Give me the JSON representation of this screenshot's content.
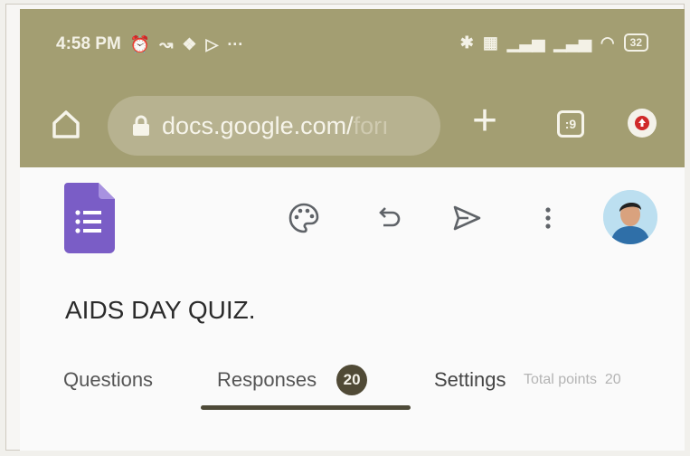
{
  "status_bar": {
    "time": "4:58 PM",
    "battery": "32"
  },
  "browser": {
    "url_main": "docs.google.com/",
    "url_faded": "forı",
    "tab_count": ":9"
  },
  "app": {
    "form_title": "AIDS DAY QUIZ.",
    "tabs": {
      "questions": "Questions",
      "responses": "Responses",
      "responses_count": "20",
      "settings": "Settings"
    },
    "total_points_label": "Total points",
    "total_points_value": "20"
  },
  "colors": {
    "chrome_bg": "#a39e72",
    "forms_purple": "#7a5dc6",
    "badge_bg": "#504a36"
  }
}
